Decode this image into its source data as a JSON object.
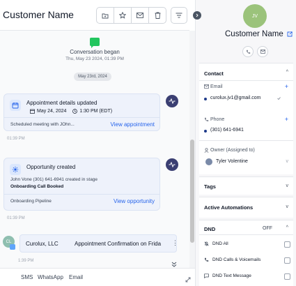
{
  "header": {
    "title": "Customer Name"
  },
  "conversation": {
    "began_title": "Conversation began",
    "began_date": "Thu, May 23 2024, 01:39 PM",
    "date_pill": "May 23rd, 2024"
  },
  "appointment_card": {
    "title": "Appointment details updated",
    "date": "May 24, 2024",
    "time": "1:30 PM (EDT)",
    "description": "Scheduled meeting with JOhn...",
    "link": "View appointment",
    "timestamp": "01:39 PM"
  },
  "opportunity_card": {
    "title": "Opportunity created",
    "line1": "John Vone (301) 641-6941 created in stage",
    "stage": "Onboarding Call Booked",
    "pipeline": "Onboarding Pipeline",
    "link": "View opportunity",
    "timestamp": "01:39 PM"
  },
  "email_message": {
    "avatar": "CL",
    "from": "Curolux, LLC",
    "subject": "Appointment Confirmation on Frida",
    "timestamp": "1:39 PM"
  },
  "bottom_tabs": [
    "SMS",
    "WhatsApp",
    "Email"
  ],
  "contact": {
    "avatar_initials": "JV",
    "name": "Customer Name",
    "section_title": "Contact",
    "email_label": "Email",
    "email_value": "curolux.jv1@gmail.com",
    "phone_label": "Phone",
    "phone_value": "(301) 641-6941",
    "owner_label": "Owner (Assigned to)",
    "owner_value": "Tyler Volentine"
  },
  "tags": {
    "title": "Tags"
  },
  "automations": {
    "title": "Active Automations"
  },
  "dnd": {
    "title": "DND",
    "status": "OFF",
    "options": [
      "DND All",
      "DND Calls & Voicemails",
      "DND Text Message"
    ]
  },
  "colors": {
    "accent": "#2563eb",
    "card_bg": "#eef2fb",
    "activity_icon": "#3b3f72",
    "avatar": "#9bc37b"
  }
}
